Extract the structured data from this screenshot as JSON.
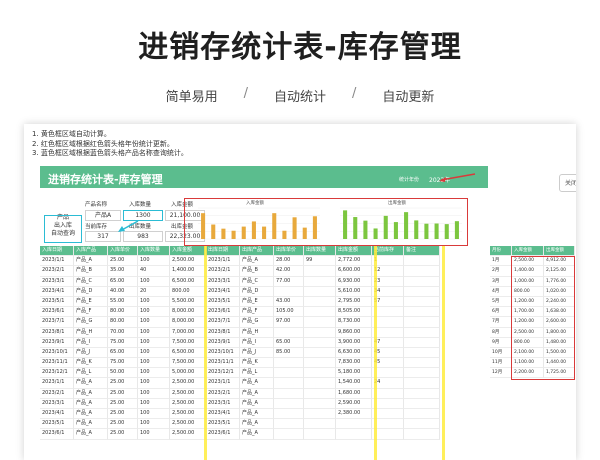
{
  "hero": {
    "title": "进销存统计表-库存管理",
    "taglines": [
      "简单易用",
      "自动统计",
      "自动更新"
    ],
    "separator": "/"
  },
  "notes": [
    "1. 黄色框区域自动计算。",
    "2. 红色框区域根据红色箭头格年份统计更新。",
    "3. 蓝色框区域根据蓝色箭头格产品名称查询统计。"
  ],
  "sheet": {
    "title": "进销存统计表-库存管理",
    "year_label": "统计年份",
    "year_value": "2023年",
    "side_tab": "关闭"
  },
  "query": {
    "label_lines": [
      "产品",
      "出入库",
      "自动查询"
    ],
    "product_name_label": "产品名称",
    "product_name_value": "产品A",
    "in_qty_label": "入库数量",
    "in_qty_value": "1300",
    "in_amount_label": "入库金额",
    "in_amount_value": "21,100.00",
    "stock_label": "当前库存",
    "stock_value": "317",
    "out_qty_label": "出库数量",
    "out_qty_value": "983",
    "out_amount_label": "出库金额",
    "out_amount_value": "22,323.00"
  },
  "charts": {
    "in_title": "入库金额",
    "out_title": "出库金额",
    "in_color": "#e8a93c",
    "out_color": "#7cc63f",
    "in_values": [
      2500,
      1400,
      1000,
      800,
      1200,
      1700,
      1200,
      2500,
      800,
      2100,
      1100,
      2200
    ],
    "out_values": [
      2772,
      2125,
      1776,
      1020,
      2240,
      1638,
      2600,
      1800,
      1480,
      1500,
      1440,
      1725
    ]
  },
  "table": {
    "headers": [
      "入库日期",
      "入库产品",
      "入库单价",
      "入库数量",
      "入库金额",
      "出库日期",
      "出库产品",
      "出库单价",
      "出库数量",
      "出库金额",
      "当前库存",
      "备注"
    ],
    "rows": [
      [
        "2023/1/1",
        "产品_A",
        "25.00",
        "100",
        "2,500.00",
        "2023/1/1",
        "产品_A",
        "28.00",
        "99",
        "2,772.00",
        "1",
        ""
      ],
      [
        "2023/2/1",
        "产品_B",
        "35.00",
        "40",
        "1,400.00",
        "2023/2/1",
        "产品_B",
        "42.00",
        "",
        "6,600.00",
        "12",
        ""
      ],
      [
        "2023/3/1",
        "产品_C",
        "65.00",
        "100",
        "6,500.00",
        "2023/3/1",
        "产品_C",
        "77.00",
        "",
        "6,930.00",
        "23",
        ""
      ],
      [
        "2023/4/1",
        "产品_D",
        "40.00",
        "20",
        "800.00",
        "2023/4/1",
        "产品_D",
        "",
        "",
        "5,610.00",
        "34",
        ""
      ],
      [
        "2023/5/1",
        "产品_E",
        "55.00",
        "100",
        "5,500.00",
        "2023/5/1",
        "产品_E",
        "43.00",
        "",
        "2,795.00",
        "57",
        ""
      ],
      [
        "2023/6/1",
        "产品_F",
        "80.00",
        "100",
        "8,000.00",
        "2023/6/1",
        "产品_F",
        "105.00",
        "",
        "8,505.00",
        "",
        ""
      ],
      [
        "2023/7/1",
        "产品_G",
        "80.00",
        "100",
        "8,000.00",
        "2023/7/1",
        "产品_G",
        "97.00",
        "",
        "8,730.00",
        "",
        ""
      ],
      [
        "2023/8/1",
        "产品_H",
        "70.00",
        "100",
        "7,000.00",
        "2023/8/1",
        "产品_H",
        "",
        "",
        "9,860.00",
        "",
        ""
      ],
      [
        "2023/9/1",
        "产品_I",
        "75.00",
        "100",
        "7,500.00",
        "2023/9/1",
        "产品_I",
        "65.00",
        "",
        "3,900.00",
        "47",
        ""
      ],
      [
        "2023/10/1",
        "产品_J",
        "65.00",
        "100",
        "6,500.00",
        "2023/10/1",
        "产品_J",
        "85.00",
        "",
        "6,630.00",
        "45",
        ""
      ],
      [
        "2023/11/1",
        "产品_K",
        "75.00",
        "100",
        "7,500.00",
        "2023/11/1",
        "产品_K",
        "",
        "",
        "7,830.00",
        "45",
        ""
      ],
      [
        "2023/12/1",
        "产品_L",
        "50.00",
        "100",
        "5,000.00",
        "2023/12/1",
        "产品_L",
        "",
        "",
        "5,180.00",
        "",
        ""
      ],
      [
        "2023/1/1",
        "产品_A",
        "25.00",
        "100",
        "2,500.00",
        "2023/1/1",
        "产品_A",
        "",
        "",
        "1,540.00",
        "24",
        ""
      ],
      [
        "2023/2/1",
        "产品_A",
        "25.00",
        "100",
        "2,500.00",
        "2023/2/1",
        "产品_A",
        "",
        "",
        "1,680.00",
        "",
        ""
      ],
      [
        "2023/3/1",
        "产品_A",
        "25.00",
        "100",
        "2,500.00",
        "2023/3/1",
        "产品_A",
        "",
        "",
        "2,590.00",
        "",
        ""
      ],
      [
        "2023/4/1",
        "产品_A",
        "25.00",
        "100",
        "2,500.00",
        "2023/4/1",
        "产品_A",
        "",
        "",
        "2,380.00",
        "",
        ""
      ],
      [
        "2023/5/1",
        "产品_A",
        "25.00",
        "100",
        "2,500.00",
        "2023/5/1",
        "产品_A",
        "",
        "",
        "",
        "",
        ""
      ],
      [
        "2023/6/1",
        "产品_A",
        "25.00",
        "100",
        "2,500.00",
        "2023/6/1",
        "产品_A",
        "",
        "",
        "",
        "",
        ""
      ]
    ]
  },
  "monthly": {
    "headers": [
      "月份",
      "入库金额",
      "出库金额"
    ],
    "rows": [
      [
        "1月",
        "2,500.00",
        "4,912.00"
      ],
      [
        "2月",
        "1,400.00",
        "2,125.00"
      ],
      [
        "3月",
        "1,000.00",
        "1,776.00"
      ],
      [
        "4月",
        "800.00",
        "1,020.00"
      ],
      [
        "5月",
        "1,200.00",
        "2,240.00"
      ],
      [
        "6月",
        "1,700.00",
        "1,638.00"
      ],
      [
        "7月",
        "1,200.00",
        "2,600.00"
      ],
      [
        "8月",
        "2,500.00",
        "1,800.00"
      ],
      [
        "9月",
        "800.00",
        "1,480.00"
      ],
      [
        "10月",
        "2,100.00",
        "1,500.00"
      ],
      [
        "11月",
        "1,100.00",
        "1,440.00"
      ],
      [
        "12月",
        "2,200.00",
        "1,725.00"
      ]
    ]
  }
}
